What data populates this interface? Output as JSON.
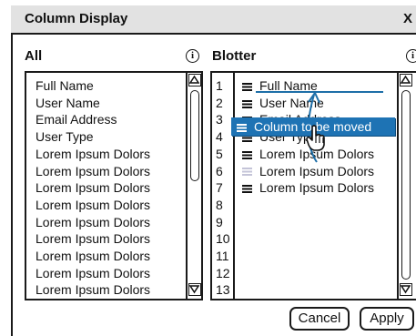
{
  "dialog": {
    "title": "Column Display",
    "close_label": "X"
  },
  "all_panel": {
    "title": "All",
    "info_icon": "info-icon",
    "items": [
      "Full Name",
      "User Name",
      "Email Address",
      "User Type",
      "Lorem Ipsum Dolors",
      "Lorem Ipsum Dolors",
      "Lorem Ipsum Dolors",
      "Lorem Ipsum Dolors",
      "Lorem Ipsum Dolors",
      "Lorem Ipsum Dolors",
      "Lorem Ipsum Dolors",
      "Lorem Ipsum Dolors",
      "Lorem Ipsum Dolors"
    ]
  },
  "blotter_panel": {
    "title": "Blotter",
    "info_icon": "info-icon",
    "row_numbers": [
      "1",
      "2",
      "3",
      "4",
      "5",
      "6",
      "7",
      "8",
      "9",
      "10",
      "11",
      "12",
      "13"
    ],
    "items": [
      "Full Name",
      "User Name",
      "Email Address",
      "User Type",
      "Lorem Ipsum Dolors",
      "Lorem Ipsum Dolors",
      "Lorem Ipsum Dolors"
    ],
    "drag_item": "Column to be moved"
  },
  "buttons": {
    "cancel": "Cancel",
    "apply": "Apply"
  },
  "colors": {
    "drag_highlight": "#1e73b4",
    "move_arrow": "#1e6fa8",
    "titlebar": "#e2e2e2"
  }
}
